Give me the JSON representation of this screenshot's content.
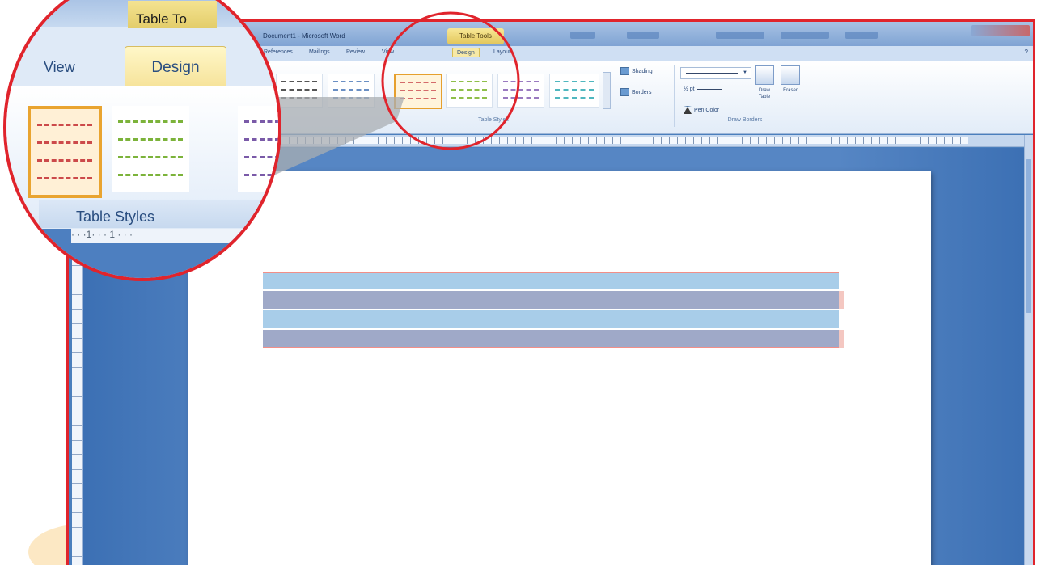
{
  "window": {
    "title": "Document1 - Microsoft Word",
    "contextual_tab": "Table Tools",
    "help": "?"
  },
  "ribbon": {
    "tabs": [
      "References",
      "Mailings",
      "Review",
      "View",
      "Design",
      "Layout"
    ],
    "active_tab": "Design",
    "shading_label": "Shading",
    "borders_label": "Borders",
    "line_weight": "½ pt",
    "pen_color_label": "Pen Color",
    "draw_table_label": "Draw Table",
    "eraser_label": "Eraser",
    "table_styles_label": "Table Styles",
    "draw_borders_label": "Draw Borders"
  },
  "magnifier": {
    "contextual_tab": "Table To",
    "tab_view": "View",
    "tab_design": "Design",
    "group_label": "Table Styles",
    "ruler_text": "· · ·1· · · 1 · · ·"
  },
  "colors": {
    "highlight": "#e0242c",
    "selected_style": "#e9a430",
    "table_row_light": "#a8cde9",
    "table_row_dark": "#9fa9c8"
  }
}
